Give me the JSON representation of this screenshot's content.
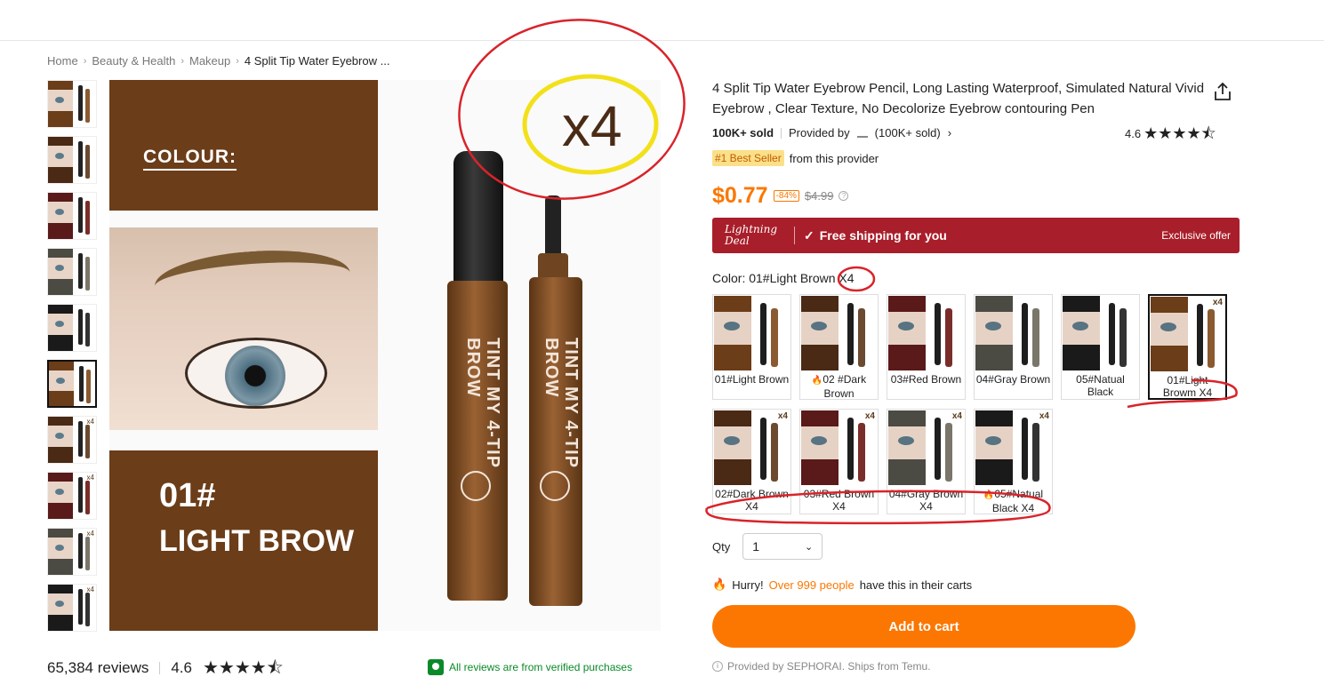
{
  "breadcrumb": [
    "Home",
    "Beauty & Health",
    "Makeup",
    "4 Split Tip Water Eyebrow ..."
  ],
  "hero": {
    "colour_label": "COLOUR:",
    "shade_number": "01#",
    "shade_name": "LIGHT BROW",
    "pen_text_a": "TINT MY 4-TIP BROW",
    "pen_text_b": "TINT MY 4-TIP BROW",
    "annotation": "x4"
  },
  "thumbs": [
    "thumb",
    "thumb",
    "thumb",
    "thumb",
    "thumb",
    "thumb",
    "thumb",
    "thumb",
    "thumb",
    "thumb"
  ],
  "product": {
    "title": "4 Split Tip Water Eyebrow Pencil, Long Lasting Waterproof, Simulated Natural Vivid Eyebrow , Clear Texture, No Decolorize Eyebrow contouring Pen",
    "sold": "100K+ sold",
    "provided_by": "Provided by",
    "provider_sold": "(100K+ sold)",
    "rating": "4.6",
    "best_tag": "#1 Best Seller",
    "best_text": "from this provider",
    "price": "$0.77",
    "discount": "-84%",
    "old_price": "$4.99"
  },
  "deal": {
    "logo": "Lightning Deal",
    "free_shipping": "Free shipping for you",
    "exclusive": "Exclusive offer"
  },
  "color": {
    "label": "Color: 01#Light Brown X4",
    "swatches": [
      {
        "label": "01#Light Brown",
        "x4": "",
        "shade": "#6b3d19",
        "pen": "#8a5a30"
      },
      {
        "label": "02 #Dark Brown",
        "x4": "",
        "shade": "#4a2a14",
        "pen": "#6b4a30",
        "fire": "🔥"
      },
      {
        "label": "03#Red Brown",
        "x4": "",
        "shade": "#5a1a1a",
        "pen": "#7a2e2a"
      },
      {
        "label": "04#Gray Brown",
        "x4": "",
        "shade": "#4b4a43",
        "pen": "#7a766a"
      },
      {
        "label": "05#Natual Black",
        "x4": "",
        "shade": "#1a1a1a",
        "pen": "#333333"
      },
      {
        "label": "01#Light Browm X4",
        "x4": "x4",
        "shade": "#6b3d19",
        "pen": "#8a5a30"
      },
      {
        "label": "02#Dark Brown X4",
        "x4": "x4",
        "shade": "#4a2a14",
        "pen": "#6b4a30"
      },
      {
        "label": "03#Red Brown X4",
        "x4": "x4",
        "shade": "#5a1a1a",
        "pen": "#7a2e2a"
      },
      {
        "label": "04#Gray Brown X4",
        "x4": "x4",
        "shade": "#4b4a43",
        "pen": "#7a766a"
      },
      {
        "label": "05#Natual Black X4",
        "x4": "x4",
        "shade": "#1a1a1a",
        "pen": "#333333",
        "fire": "🔥"
      }
    ]
  },
  "qty": {
    "label": "Qty",
    "value": "1"
  },
  "hurry": {
    "prefix": "Hurry!",
    "highlight": "Over 999 people",
    "suffix": "have this in their carts"
  },
  "cart_button": "Add to cart",
  "provided_line": "Provided by SEPHORAI. Ships from Temu.",
  "reviews": {
    "count": "65,384 reviews",
    "rating": "4.6"
  },
  "verified": "All reviews are from verified purchases",
  "colors": {
    "accent": "#fb7701",
    "deal": "#a81e2a",
    "verified": "#0a8a28"
  }
}
